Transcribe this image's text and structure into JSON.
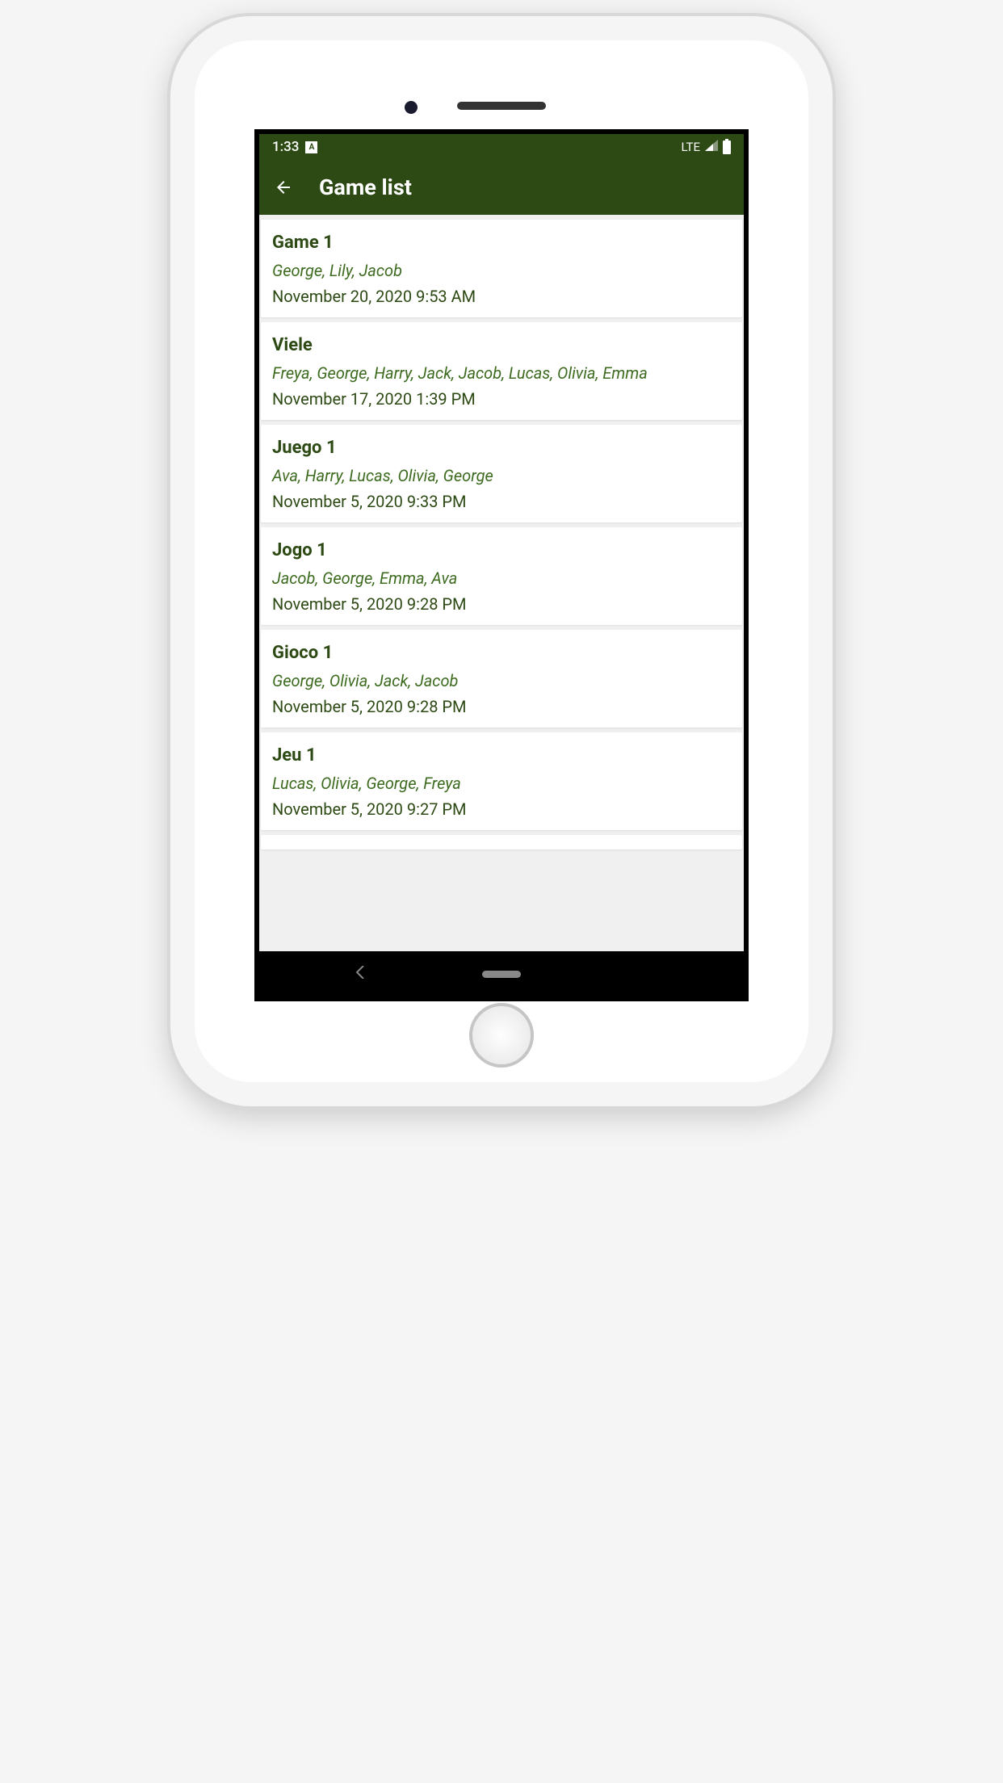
{
  "statusBar": {
    "time": "1:33",
    "network": "LTE"
  },
  "appBar": {
    "title": "Game list"
  },
  "games": [
    {
      "title": "Game 1",
      "players": "George, Lily, Jacob",
      "date": "November 20, 2020 9:53 AM"
    },
    {
      "title": "Viele",
      "players": "Freya, George, Harry, Jack, Jacob, Lucas, Olivia, Emma",
      "date": "November 17, 2020 1:39 PM"
    },
    {
      "title": "Juego 1",
      "players": "Ava, Harry, Lucas, Olivia, George",
      "date": "November 5, 2020 9:33 PM"
    },
    {
      "title": "Jogo 1",
      "players": "Jacob, George, Emma, Ava",
      "date": "November 5, 2020 9:28 PM"
    },
    {
      "title": "Gioco 1",
      "players": "George, Olivia, Jack, Jacob",
      "date": "November 5, 2020 9:28 PM"
    },
    {
      "title": "Jeu 1",
      "players": "Lucas, Olivia, George, Freya",
      "date": "November 5, 2020 9:27 PM"
    }
  ]
}
